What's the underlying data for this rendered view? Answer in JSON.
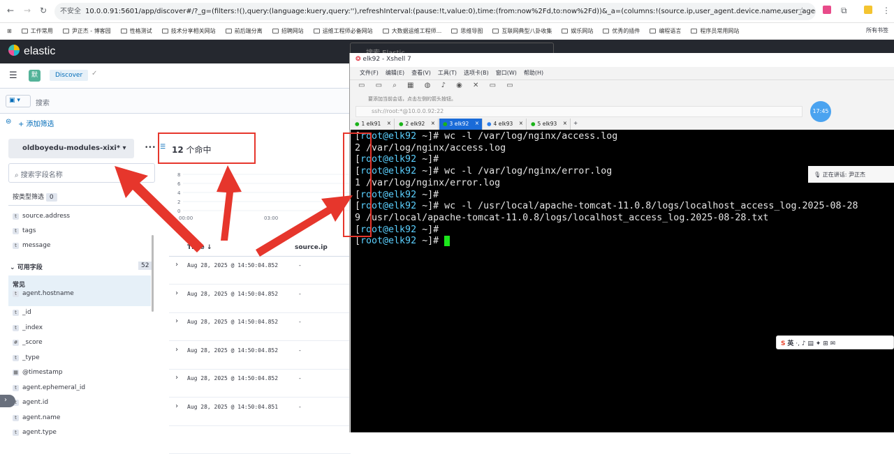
{
  "browser": {
    "url_warning": "不安全",
    "url": "10.0.0.91:5601/app/discover#/?_g=(filters:!(),query:(language:kuery,query:''),refreshInterval:(pause:!t,value:0),time:(from:now%2Fd,to:now%2Fd))&_a=(columns:!(source.ip,user_agent.device.name,user_agent.name,user_a...",
    "bookmarks": [
      "工作常用",
      "尹正杰 - 博客园",
      "性格测试",
      "技术分享相关网站",
      "前后端分离",
      "招聘网站",
      "运维工程师必备网站",
      "大数据运维工程师...",
      "思维导图",
      "互联网典型八卦收集",
      "娱乐网站",
      "优秀的插件",
      "编程语言",
      "程序员常用网站"
    ],
    "all_bookmarks": "所有书签"
  },
  "kibana": {
    "logo": "elastic",
    "search_top": "搜索 Elastic",
    "app": "Discover",
    "query_placeholder": "搜索",
    "add_filter": "+ 添加筛选",
    "index": "oldboyedu-modules-xixi*",
    "field_search": "搜索字段名称",
    "filter_by_type": "按类型筛选",
    "filter_count": "0",
    "selected_fields": [
      "source.address",
      "tags",
      "message"
    ],
    "available_label": "可用字段",
    "available_count": "52",
    "common_label": "常见",
    "fields": [
      {
        "t": "t",
        "n": "agent.hostname"
      },
      {
        "t": "t",
        "n": "_id"
      },
      {
        "t": "t",
        "n": "_index"
      },
      {
        "t": "#",
        "n": "_score"
      },
      {
        "t": "t",
        "n": "_type"
      },
      {
        "t": "▦",
        "n": "@timestamp"
      },
      {
        "t": "t",
        "n": "agent.ephemeral_id"
      },
      {
        "t": "t",
        "n": "agent.id"
      },
      {
        "t": "t",
        "n": "agent.name"
      },
      {
        "t": "t",
        "n": "agent.type"
      }
    ],
    "hits": "12",
    "hits_label": "个命中",
    "y_ticks": [
      "8",
      "6",
      "4",
      "2",
      "0"
    ],
    "x_ticks": [
      "00:00",
      "03:00"
    ],
    "col_time": "Time",
    "col_src": "source.ip",
    "rows": [
      {
        "t": "Aug 28, 2025 @ 14:50:04.852",
        "v": "-"
      },
      {
        "t": "Aug 28, 2025 @ 14:50:04.852",
        "v": "-"
      },
      {
        "t": "Aug 28, 2025 @ 14:50:04.852",
        "v": "-"
      },
      {
        "t": "Aug 28, 2025 @ 14:50:04.852",
        "v": "-"
      },
      {
        "t": "Aug 28, 2025 @ 14:50:04.852",
        "v": "-"
      },
      {
        "t": "Aug 28, 2025 @ 14:50:04.851",
        "v": "-"
      }
    ]
  },
  "xshell": {
    "title": "elk92 - Xshell 7",
    "menu": [
      "文件(F)",
      "编辑(E)",
      "查看(V)",
      "工具(T)",
      "选项卡(B)",
      "窗口(W)",
      "帮助(H)"
    ],
    "hint": "要添加当前会话，点击左侧的箭头按钮。",
    "session": "ssh://root:*@10.0.0.92:22",
    "clock": "17:45",
    "tabs": [
      {
        "n": "1 elk91",
        "c": "#1ab319"
      },
      {
        "n": "2 elk92",
        "c": "#1ab319"
      },
      {
        "n": "3 elk92",
        "c": "#1ab319",
        "active": true
      },
      {
        "n": "4 elk93",
        "c": "#2f80ed"
      },
      {
        "n": "5 elk93",
        "c": "#1ab319"
      }
    ],
    "lines": [
      {
        "p": true,
        "c": "wc -l /var/log/nginx/access.log"
      },
      {
        "o": "2 /var/log/nginx/access.log"
      },
      {
        "p": true,
        "c": ""
      },
      {
        "p": true,
        "c": "wc -l /var/log/nginx/error.log"
      },
      {
        "o": "1 /var/log/nginx/error.log"
      },
      {
        "p": true,
        "c": ""
      },
      {
        "p": true,
        "c": "wc -l /usr/local/apache-tomcat-11.0.8/logs/localhost_access_log.2025-08-28"
      },
      {
        "o": "9 /usr/local/apache-tomcat-11.0.8/logs/localhost_access_log.2025-08-28.txt"
      },
      {
        "p": true,
        "c": ""
      },
      {
        "p": true,
        "c": "",
        "cursor": true
      }
    ],
    "prompt_user": "root@elk92",
    "prompt_rest": " ~]# ",
    "speaking": "正在讲话: 尹正杰",
    "ime": "英"
  }
}
